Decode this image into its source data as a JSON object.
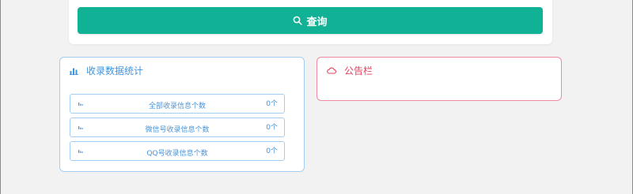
{
  "query": {
    "button_label": "查询",
    "icon": "search-icon"
  },
  "stats_panel": {
    "title": "收录数据统计",
    "icon": "bar-chart-icon",
    "rows": [
      {
        "label": "全部收录信息个数",
        "count": "0个",
        "icon": "small-chart-icon"
      },
      {
        "label": "微信号收录信息个数",
        "count": "0个",
        "icon": "small-chart-icon"
      },
      {
        "label": "QQ号收录信息个数",
        "count": "0个",
        "icon": "small-chart-icon"
      }
    ]
  },
  "notice_panel": {
    "title": "公告栏",
    "icon": "cloud-icon"
  },
  "colors": {
    "primary_green": "#11b195",
    "stats_blue": "#3d95e0",
    "notice_red": "#e2435f"
  }
}
